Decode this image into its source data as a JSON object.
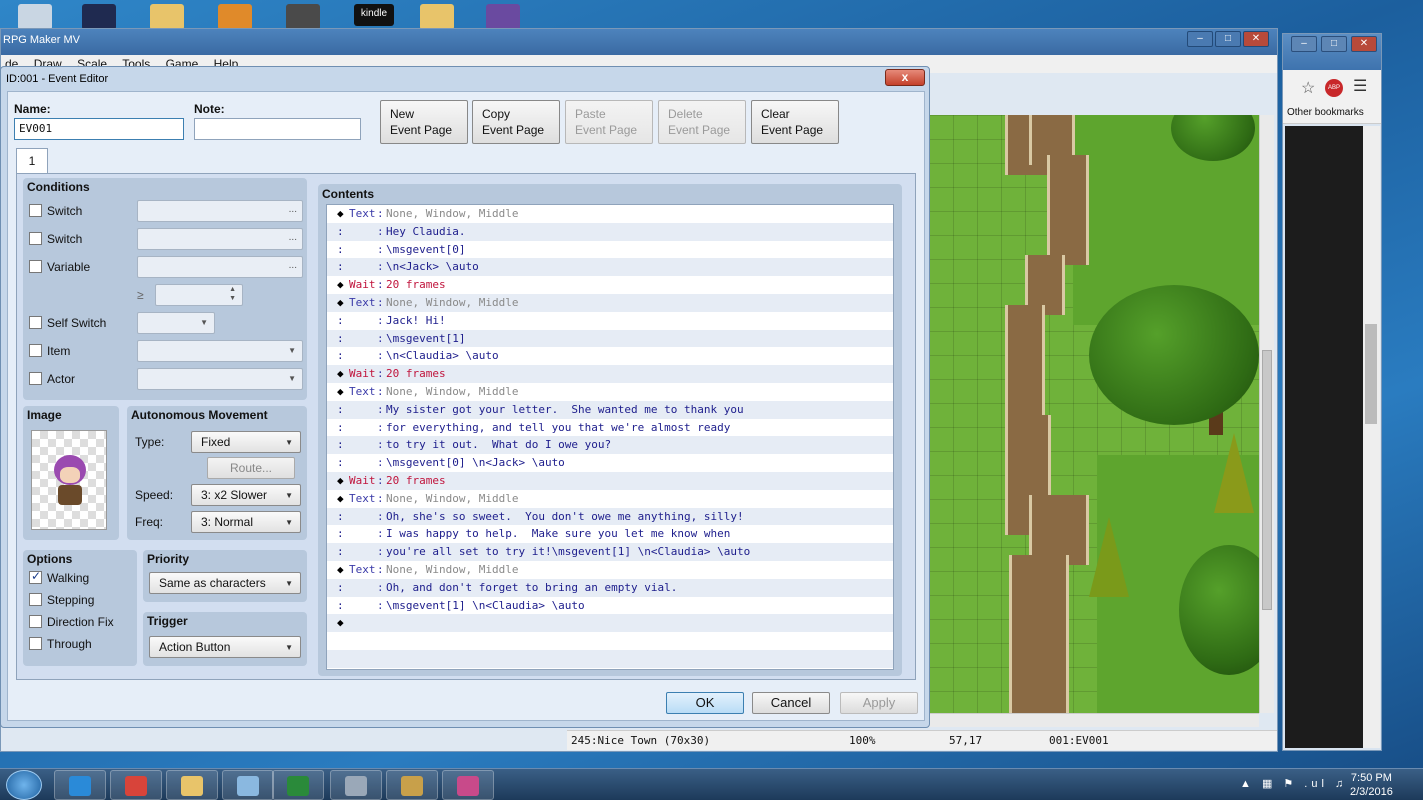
{
  "desktop": {
    "icons": [
      {
        "name": "recycle-bin-icon",
        "color": "#c9d6e3"
      },
      {
        "name": "league-of-legends-icon",
        "color": "#1f2a50"
      },
      {
        "name": "folder-icon",
        "color": "#e8c46a"
      },
      {
        "name": "fox-app-icon",
        "color": "#e08a2a"
      },
      {
        "name": "game-shortcut-icon",
        "color": "#4a4a4a"
      },
      {
        "name": "kindle-icon",
        "label": "kindle"
      },
      {
        "name": "folder-2-icon",
        "color": "#e8c46a"
      },
      {
        "name": "character-icon",
        "color": "#6a4aa0"
      }
    ]
  },
  "browser": {
    "bookmarks_label": "Other bookmarks",
    "abp_label": "ABP"
  },
  "rpg": {
    "title": "RPG Maker MV",
    "menu": [
      "de",
      "Draw",
      "Scale",
      "Tools",
      "Game",
      "Help"
    ],
    "status": {
      "map": "245:Nice Town (70x30)",
      "zoom": "100%",
      "coords": "57,17",
      "event": "001:EV001"
    }
  },
  "editor": {
    "title": "ID:001 - Event Editor",
    "close": "x",
    "name_label": "Name:",
    "name_value": "EV001",
    "note_label": "Note:",
    "note_value": "",
    "page_buttons": [
      {
        "line1": "New",
        "line2": "Event Page",
        "enabled": true
      },
      {
        "line1": "Copy",
        "line2": "Event Page",
        "enabled": true
      },
      {
        "line1": "Paste",
        "line2": "Event Page",
        "enabled": false
      },
      {
        "line1": "Delete",
        "line2": "Event Page",
        "enabled": false
      },
      {
        "line1": "Clear",
        "line2": "Event Page",
        "enabled": true
      }
    ],
    "tab": "1",
    "conditions": {
      "title": "Conditions",
      "switch1": "Switch",
      "switch2": "Switch",
      "variable": "Variable",
      "gte": "≥",
      "self_switch": "Self Switch",
      "item": "Item",
      "actor": "Actor",
      "dots": "..."
    },
    "image": {
      "title": "Image"
    },
    "movement": {
      "title": "Autonomous Movement",
      "type_label": "Type:",
      "type_value": "Fixed",
      "route": "Route...",
      "speed_label": "Speed:",
      "speed_value": "3: x2 Slower",
      "freq_label": "Freq:",
      "freq_value": "3: Normal"
    },
    "options": {
      "title": "Options",
      "walking": "Walking",
      "walking_checked": true,
      "stepping": "Stepping",
      "direction_fix": "Direction Fix",
      "through": "Through"
    },
    "priority": {
      "title": "Priority",
      "value": "Same as characters"
    },
    "trigger": {
      "title": "Trigger",
      "value": "Action Button"
    },
    "contents_title": "Contents",
    "commands": [
      {
        "marker": "◆",
        "cmd": "Text",
        "colon": ":",
        "text": "None, Window, Middle",
        "kind": "text"
      },
      {
        "marker": ":",
        "cmd": "",
        "colon": ":",
        "text": "Hey Claudia.",
        "kind": "msg"
      },
      {
        "marker": ":",
        "cmd": "",
        "colon": ":",
        "text": "\\msgevent[0]",
        "kind": "msg"
      },
      {
        "marker": ":",
        "cmd": "",
        "colon": ":",
        "text": "\\n<Jack> \\auto",
        "kind": "msg"
      },
      {
        "marker": "◆",
        "cmd": "Wait",
        "colon": ":",
        "text": "20 frames",
        "kind": "wait"
      },
      {
        "marker": "◆",
        "cmd": "Text",
        "colon": ":",
        "text": "None, Window, Middle",
        "kind": "text"
      },
      {
        "marker": ":",
        "cmd": "",
        "colon": ":",
        "text": "Jack! Hi!",
        "kind": "msg"
      },
      {
        "marker": ":",
        "cmd": "",
        "colon": ":",
        "text": "\\msgevent[1]",
        "kind": "msg"
      },
      {
        "marker": ":",
        "cmd": "",
        "colon": ":",
        "text": "\\n<Claudia> \\auto",
        "kind": "msg"
      },
      {
        "marker": "◆",
        "cmd": "Wait",
        "colon": ":",
        "text": "20 frames",
        "kind": "wait"
      },
      {
        "marker": "◆",
        "cmd": "Text",
        "colon": ":",
        "text": "None, Window, Middle",
        "kind": "text"
      },
      {
        "marker": ":",
        "cmd": "",
        "colon": ":",
        "text": "My sister got your letter.  She wanted me to thank you",
        "kind": "msg"
      },
      {
        "marker": ":",
        "cmd": "",
        "colon": ":",
        "text": "for everything, and tell you that we're almost ready",
        "kind": "msg"
      },
      {
        "marker": ":",
        "cmd": "",
        "colon": ":",
        "text": "to try it out.  What do I owe you?",
        "kind": "msg"
      },
      {
        "marker": ":",
        "cmd": "",
        "colon": ":",
        "text": "\\msgevent[0] \\n<Jack> \\auto",
        "kind": "msg"
      },
      {
        "marker": "◆",
        "cmd": "Wait",
        "colon": ":",
        "text": "20 frames",
        "kind": "wait"
      },
      {
        "marker": "◆",
        "cmd": "Text",
        "colon": ":",
        "text": "None, Window, Middle",
        "kind": "text"
      },
      {
        "marker": ":",
        "cmd": "",
        "colon": ":",
        "text": "Oh, she's so sweet.  You don't owe me anything, silly!",
        "kind": "msg"
      },
      {
        "marker": ":",
        "cmd": "",
        "colon": ":",
        "text": "I was happy to help.  Make sure you let me know when",
        "kind": "msg"
      },
      {
        "marker": ":",
        "cmd": "",
        "colon": ":",
        "text": "you're all set to try it!\\msgevent[1] \\n<Claudia> \\auto",
        "kind": "msg"
      },
      {
        "marker": "◆",
        "cmd": "Text",
        "colon": ":",
        "text": "None, Window, Middle",
        "kind": "text"
      },
      {
        "marker": ":",
        "cmd": "",
        "colon": ":",
        "text": "Oh, and don't forget to bring an empty vial.",
        "kind": "msg"
      },
      {
        "marker": ":",
        "cmd": "",
        "colon": ":",
        "text": "\\msgevent[1] \\n<Claudia> \\auto",
        "kind": "msg"
      },
      {
        "marker": "◆",
        "cmd": "",
        "colon": "",
        "text": "",
        "kind": "end"
      },
      {
        "marker": "",
        "cmd": "",
        "colon": "",
        "text": "",
        "kind": "blank"
      },
      {
        "marker": "",
        "cmd": "",
        "colon": "",
        "text": "",
        "kind": "blank"
      }
    ],
    "ok": "OK",
    "cancel": "Cancel",
    "apply": "Apply"
  },
  "taskbar": {
    "items": [
      {
        "name": "ie-icon",
        "color": "#2a8ad8"
      },
      {
        "name": "chrome-icon",
        "color": "#d8443a"
      },
      {
        "name": "explorer-icon",
        "color": "#e8c46a"
      },
      {
        "name": "notepad-icon",
        "color": "#8ab8e0"
      },
      {
        "name": "excel-icon",
        "color": "#2a8a3a"
      },
      {
        "name": "calculator-icon",
        "color": "#9aa8b8"
      },
      {
        "name": "league-icon",
        "color": "#c8a04a"
      },
      {
        "name": "rpg-maker-icon",
        "color": "#c84a8a"
      }
    ],
    "tray": "▲ ▦ ⚑ .ul ♫",
    "time": "7:50 PM",
    "date": "2/3/2016"
  },
  "colors": {
    "accent": "#3a6aa3",
    "wait": "#c0143c",
    "text_cmd": "#3a3aa8"
  }
}
